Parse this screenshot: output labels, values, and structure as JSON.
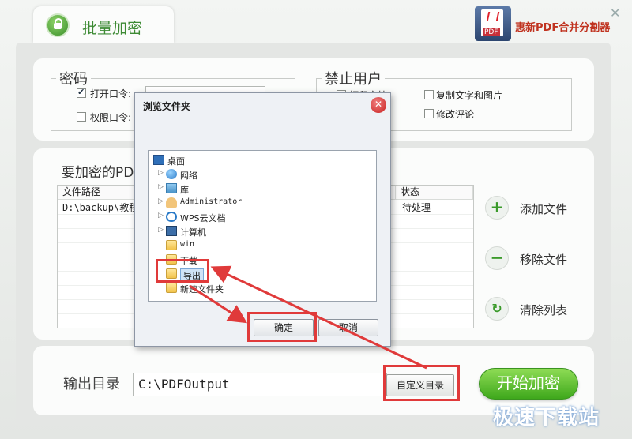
{
  "app": {
    "title": "批量加密",
    "brand": "惠新PDF合并分割器",
    "close_glyph": "✕",
    "logo_text": "PDF"
  },
  "password_section": {
    "legend": "密码",
    "open_password_label": "打开口令:",
    "open_password_checked": true,
    "permission_password_label": "权限口令:",
    "permission_password_checked": false,
    "open_password_value": "",
    "permission_password_value": ""
  },
  "restrict_section": {
    "legend": "禁止用户",
    "options": [
      {
        "label": "打印文档",
        "checked": false
      },
      {
        "label": "复制文字和图片",
        "checked": false
      },
      {
        "label": "修改评论",
        "checked": false
      }
    ]
  },
  "file_list": {
    "title": "要加密的PDF文件",
    "columns": [
      "文件路径",
      "状态"
    ],
    "rows": [
      {
        "path": "D:\\backup\\教程素材\\示例文档.pdf",
        "status": "待处理"
      }
    ]
  },
  "actions": {
    "add": "添加文件",
    "remove": "移除文件",
    "clear": "清除列表",
    "add_glyph": "+",
    "remove_glyph": "−",
    "clear_glyph": "↻"
  },
  "output": {
    "label": "输出目录",
    "path": "C:\\PDFOutput",
    "custom_button": "自定义目录",
    "start_button": "开始加密"
  },
  "dialog": {
    "title": "浏览文件夹",
    "close_glyph": "✕",
    "tree": [
      {
        "name": "桌面",
        "icon": "desktop-icon",
        "expandable": false
      },
      {
        "name": "网络",
        "icon": "network-icon",
        "expandable": true
      },
      {
        "name": "库",
        "icon": "library-icon",
        "expandable": true
      },
      {
        "name": "Administrator",
        "icon": "user-folder-icon",
        "expandable": true
      },
      {
        "name": "WPS云文档",
        "icon": "cloud-icon",
        "expandable": true
      },
      {
        "name": "计算机",
        "icon": "computer-icon",
        "expandable": true
      },
      {
        "name": "win",
        "icon": "folder-icon",
        "expandable": false
      },
      {
        "name": "下载",
        "icon": "folder-icon",
        "expandable": false
      },
      {
        "name": "导出",
        "icon": "folder-icon",
        "expandable": false,
        "selected": true
      },
      {
        "name": "新建文件夹",
        "icon": "folder-icon",
        "expandable": false
      }
    ],
    "ok_button": "确定",
    "cancel_button": "取消"
  },
  "watermark": "极速下载站",
  "colors": {
    "accent_green": "#3fa81c",
    "highlight_red": "#e03a3a",
    "brand_red": "#c03320"
  }
}
